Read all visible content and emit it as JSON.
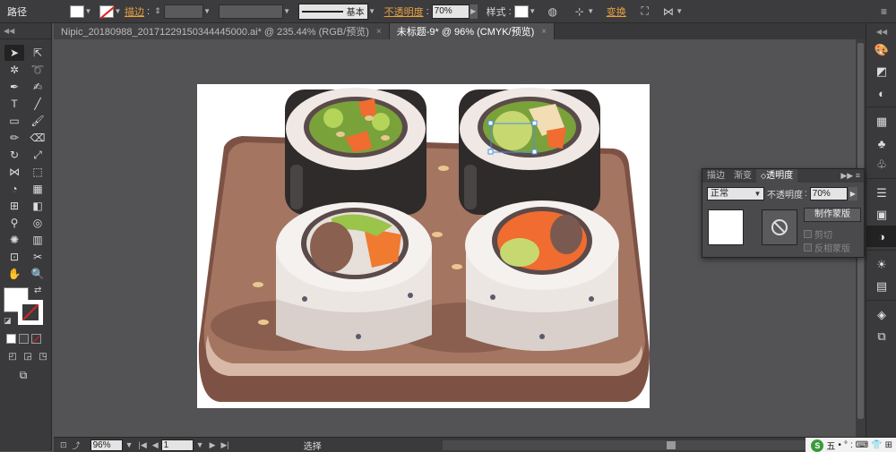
{
  "control_bar": {
    "selection_label": "路径",
    "stroke_label": "描边",
    "stroke_profile_label": "基本",
    "opacity_label": "不透明度",
    "opacity_value": "70%",
    "style_label": "样式",
    "transform_label": "变换"
  },
  "tabs": [
    {
      "label": "Nipic_20180988_20171229150344445000.ai* @ 235.44% (RGB/预览)",
      "close": "×",
      "active": false
    },
    {
      "label": "未标题-9* @ 96% (CMYK/预览)",
      "close": "×",
      "active": true
    }
  ],
  "transparency_panel": {
    "tabs": [
      "描边",
      "渐变",
      "透明度"
    ],
    "blend_mode": "正常",
    "opacity_label": "不透明度",
    "opacity_value": "70%",
    "make_mask_button": "制作蒙版",
    "clip_label": "剪切",
    "invert_mask_label": "反相蒙版"
  },
  "status_bar": {
    "zoom": "96%",
    "page": "1",
    "status_text": "选择"
  },
  "ime_tray": {
    "logo": "S",
    "mode": "五",
    "items": [
      "•",
      "°",
      ":",
      "⌨",
      "👕",
      "⊞"
    ]
  },
  "colors": {
    "ui_bg": "#535356",
    "panel_bg": "#3a3a3c",
    "accent_orange": "#e8a040",
    "board_brown": "#a47561",
    "seaweed": "#3a3535",
    "rice": "#ece6e3",
    "carrot": "#f06c30",
    "cucumber": "#9ac44a"
  }
}
